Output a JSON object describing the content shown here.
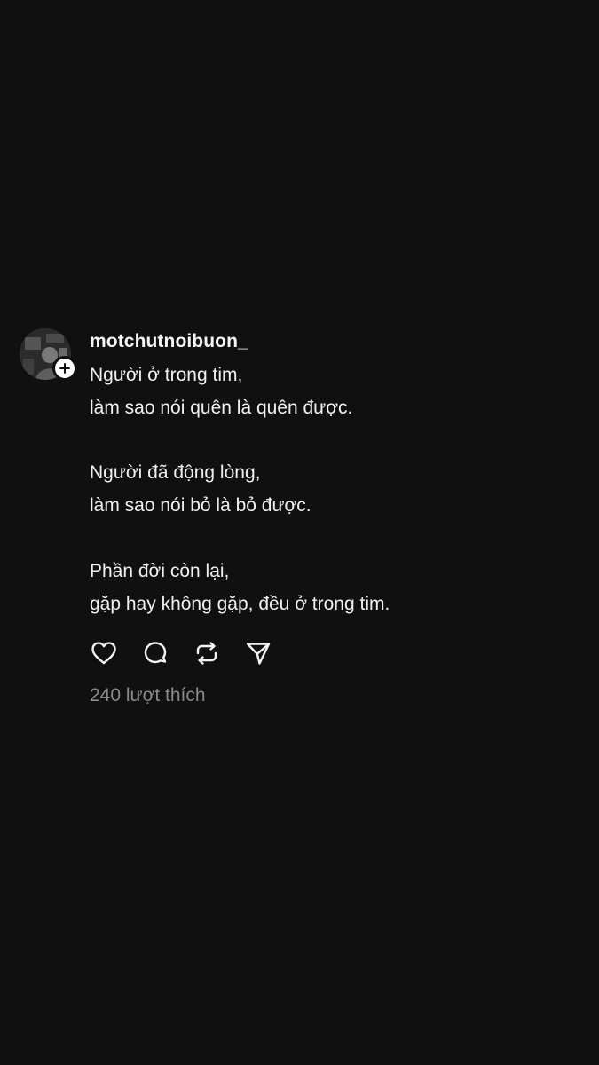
{
  "post": {
    "username": "motchutnoibuon_",
    "lines": [
      "Người ở trong tim,",
      "làm sao nói quên là quên được.",
      "",
      "Người đã động lòng,",
      "làm sao nói bỏ là bỏ được.",
      "",
      "Phần đời còn lại,",
      "gặp hay không gặp, đều ở trong tim."
    ],
    "likes_label": "240 lượt thích"
  },
  "icons": {
    "like": "heart-icon",
    "comment": "comment-bubble-icon",
    "repost": "repost-icon",
    "share": "send-icon",
    "follow": "plus-icon"
  },
  "colors": {
    "background": "#101010",
    "text": "#f0f0f0",
    "muted": "#8a8a8a"
  }
}
